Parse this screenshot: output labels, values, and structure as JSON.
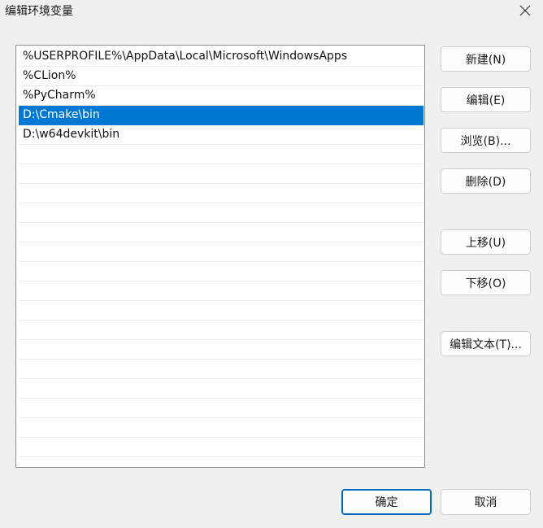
{
  "window": {
    "title": "编辑环境变量"
  },
  "path_list": {
    "items": [
      "%USERPROFILE%\\AppData\\Local\\Microsoft\\WindowsApps",
      "%CLion%",
      "%PyCharm%",
      "D:\\Cmake\\bin",
      "D:\\w64devkit\\bin",
      "",
      "",
      "",
      "",
      "",
      "",
      "",
      "",
      "",
      "",
      "",
      "",
      "",
      "",
      "",
      ""
    ],
    "selected_index": 3
  },
  "side_buttons": {
    "new": "新建(N)",
    "edit": "编辑(E)",
    "browse": "浏览(B)...",
    "delete": "删除(D)",
    "move_up": "上移(U)",
    "move_down": "下移(O)",
    "edit_text": "编辑文本(T)..."
  },
  "footer": {
    "ok": "确定",
    "cancel": "取消"
  },
  "colors": {
    "selection": "#0078d4",
    "primary_border": "#0067c0",
    "background": "#f0f0f0"
  }
}
